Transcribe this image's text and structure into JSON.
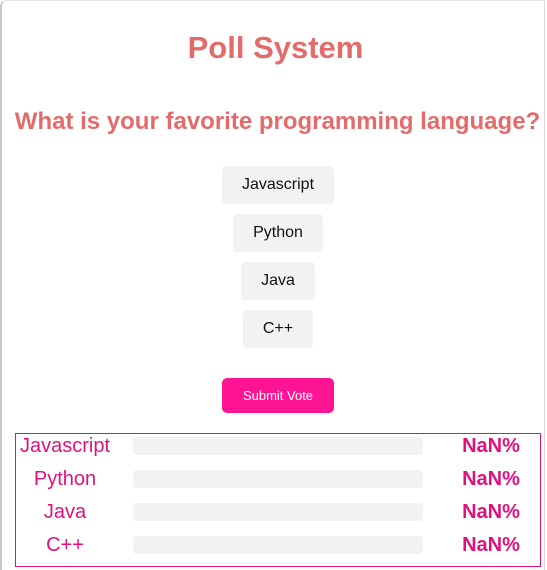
{
  "poll": {
    "title": "Poll System",
    "question": "What is your favorite programming language?",
    "options": [
      {
        "label": "Javascript"
      },
      {
        "label": "Python"
      },
      {
        "label": "Java"
      },
      {
        "label": "C++"
      }
    ],
    "submit_label": "Submit Vote"
  },
  "results": {
    "rows": [
      {
        "label": "Javascript",
        "percent_text": "NaN%"
      },
      {
        "label": "Python",
        "percent_text": "NaN%"
      },
      {
        "label": "Java",
        "percent_text": "NaN%"
      },
      {
        "label": "C++",
        "percent_text": "NaN%"
      }
    ]
  },
  "colors": {
    "heading": "#e36b6b",
    "accent": "#ff1493",
    "results_text": "#e0117f",
    "option_bg": "#f2f2f2"
  }
}
